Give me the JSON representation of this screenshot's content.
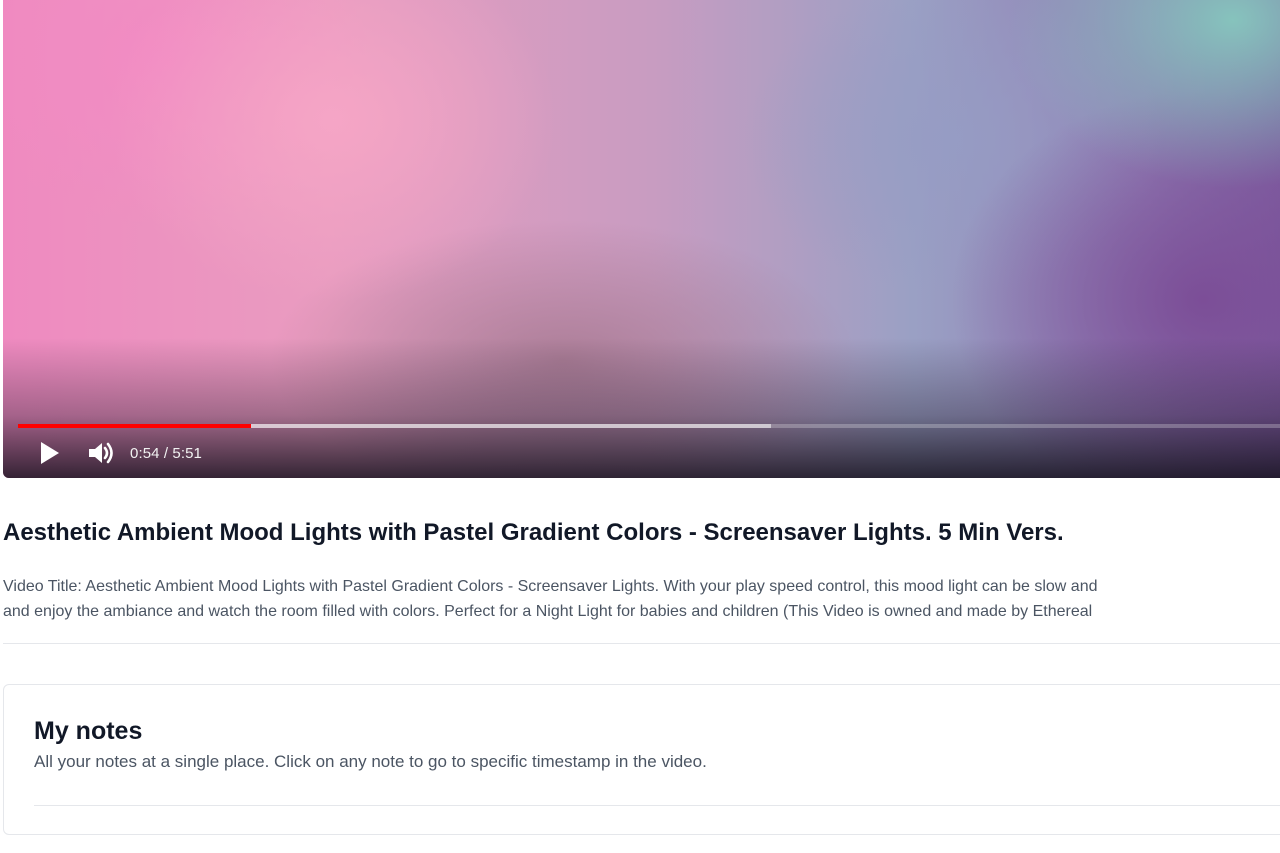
{
  "player": {
    "current_time": "0:54",
    "duration": "5:51",
    "time_display": "0:54 / 5:51",
    "played_fraction": 0.182,
    "buffered_fraction": 0.588,
    "play_icon": "play-icon",
    "volume_icon": "volume-icon",
    "progress_color": "#ff0000"
  },
  "video": {
    "title": "Aesthetic Ambient Mood Lights with Pastel Gradient Colors - Screensaver Lights. 5 Min Vers.",
    "description_lines": [
      "Video Title: Aesthetic Ambient Mood Lights with Pastel Gradient Colors - Screensaver Lights. With your play speed control, this mood light can be slow and",
      "and enjoy the ambiance and watch the room filled with colors. Perfect for a Night Light for babies and children (This Video is owned and made by Ethereal"
    ]
  },
  "notes": {
    "title": "My notes",
    "subtitle": "All your notes at a single place. Click on any note to go to specific timestamp in the video."
  }
}
